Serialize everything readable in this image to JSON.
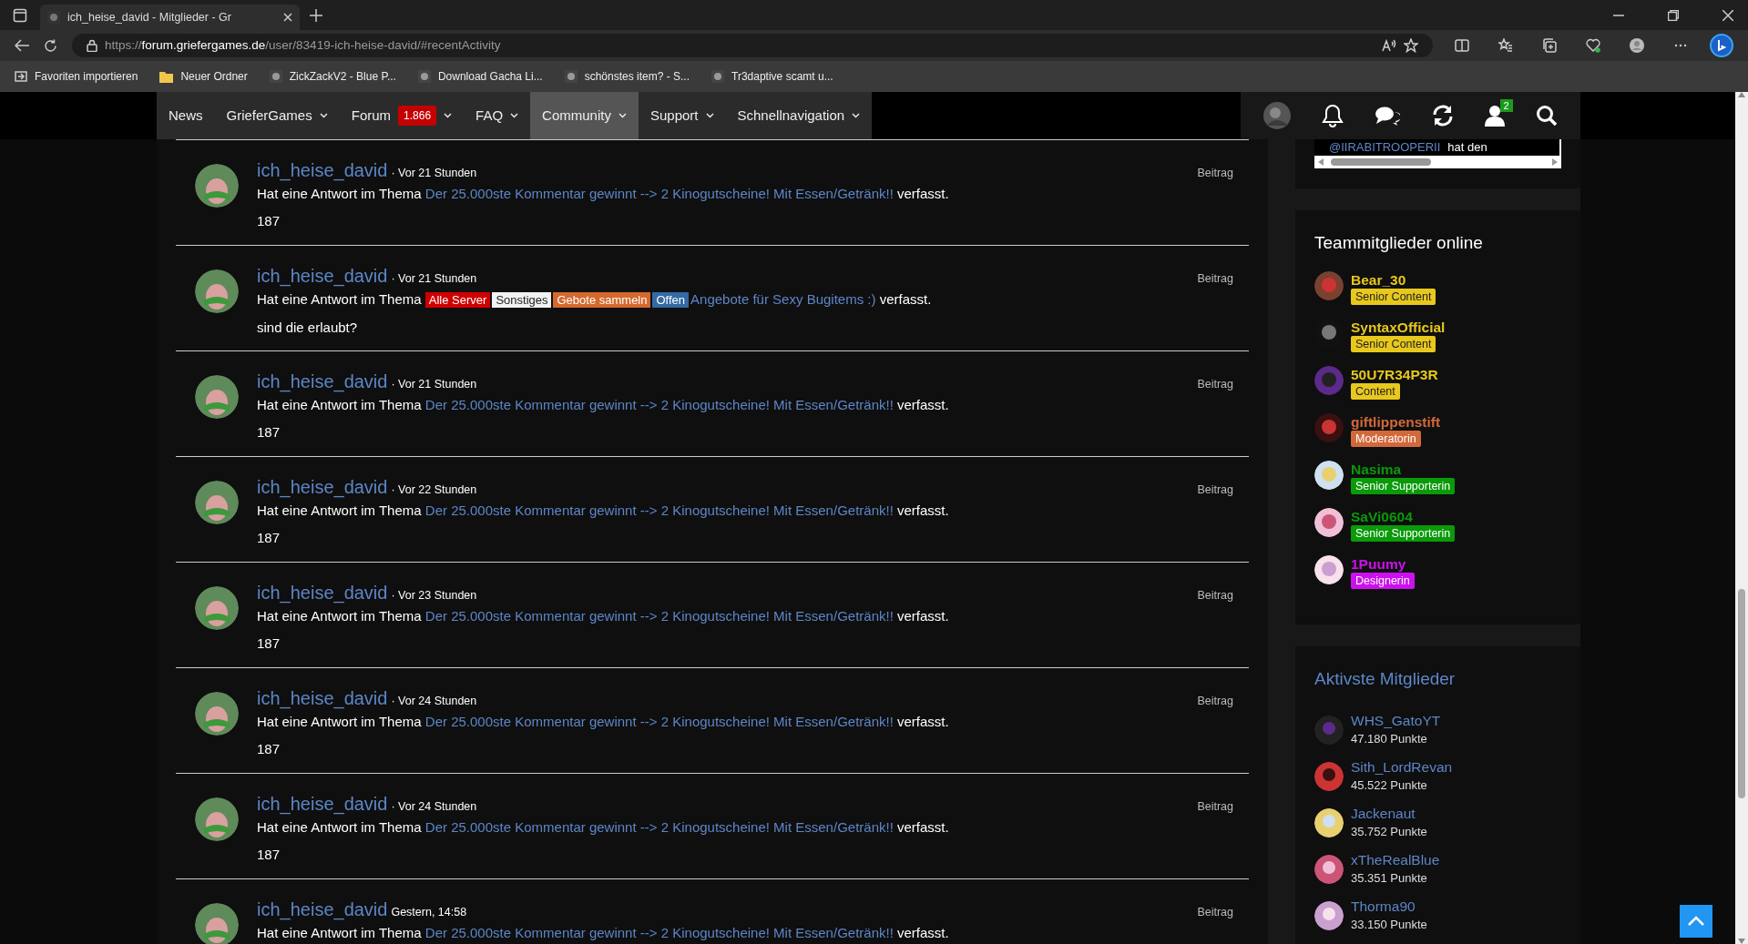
{
  "browser": {
    "tabs": [
      {
        "title": "ich_heise_david - Mitglieder - Gr",
        "selected": true
      }
    ],
    "address": {
      "scheme": "https://",
      "host": "forum.griefergames.de",
      "path": "/user/83419-ich-heise-david/#recentActivity"
    },
    "bookmarks": [
      {
        "label": "Favoriten importieren",
        "kind": "import"
      },
      {
        "label": "Neuer Ordner",
        "kind": "folder"
      },
      {
        "label": "ZickZackV2 - Blue P...",
        "kind": "page"
      },
      {
        "label": "Download Gacha Li...",
        "kind": "page"
      },
      {
        "label": "schönstes item? - S...",
        "kind": "page"
      },
      {
        "label": "Tr3daptive scamt u...",
        "kind": "page"
      }
    ]
  },
  "nav": {
    "items": [
      {
        "label": "News",
        "dropdown": false,
        "selected": false
      },
      {
        "label": "GrieferGames",
        "dropdown": true,
        "selected": false
      },
      {
        "label": "Forum",
        "dropdown": true,
        "badge": "1.866",
        "selected": false
      },
      {
        "label": "FAQ",
        "dropdown": true,
        "selected": false
      },
      {
        "label": "Community",
        "dropdown": true,
        "selected": true
      },
      {
        "label": "Support",
        "dropdown": true,
        "selected": false
      },
      {
        "label": "Schnellnavigation",
        "dropdown": true,
        "selected": false
      }
    ],
    "user_badge": "2"
  },
  "feed": {
    "items": [
      {
        "user": "ich_heise_david",
        "time": "· Vor 21 Stunden",
        "prefix": "Hat eine Antwort im Thema",
        "topic": "Der 25.000ste Kommentar gewinnt --> 2 Kinogutscheine! Mit Essen/Getränk!!",
        "suffix": "verfasst.",
        "body": "187",
        "type": "Beitrag"
      },
      {
        "user": "ich_heise_david",
        "time": "· Vor 21 Stunden",
        "prefix": "Hat eine Antwort im Thema",
        "tags": [
          {
            "label": "Alle Server",
            "color": "#d10000"
          },
          {
            "label": "Sonstiges",
            "color": "#f2f2f2"
          },
          {
            "label": "Gebote sammeln",
            "color": "#d4692e"
          },
          {
            "label": "Offen",
            "color": "#336aa6"
          }
        ],
        "topic": "Angebote für Sexy Bugitems :)",
        "suffix": "verfasst.",
        "body": "sind die erlaubt?",
        "type": "Beitrag"
      },
      {
        "user": "ich_heise_david",
        "time": "· Vor 21 Stunden",
        "prefix": "Hat eine Antwort im Thema",
        "topic": "Der 25.000ste Kommentar gewinnt --> 2 Kinogutscheine! Mit Essen/Getränk!!",
        "suffix": "verfasst.",
        "body": "187",
        "type": "Beitrag"
      },
      {
        "user": "ich_heise_david",
        "time": "· Vor 22 Stunden",
        "prefix": "Hat eine Antwort im Thema",
        "topic": "Der 25.000ste Kommentar gewinnt --> 2 Kinogutscheine! Mit Essen/Getränk!!",
        "suffix": "verfasst.",
        "body": "187",
        "type": "Beitrag"
      },
      {
        "user": "ich_heise_david",
        "time": "· Vor 23 Stunden",
        "prefix": "Hat eine Antwort im Thema",
        "topic": "Der 25.000ste Kommentar gewinnt --> 2 Kinogutscheine! Mit Essen/Getränk!!",
        "suffix": "verfasst.",
        "body": "187",
        "type": "Beitrag"
      },
      {
        "user": "ich_heise_david",
        "time": "· Vor 24 Stunden",
        "prefix": "Hat eine Antwort im Thema",
        "topic": "Der 25.000ste Kommentar gewinnt --> 2 Kinogutscheine! Mit Essen/Getränk!!",
        "suffix": "verfasst.",
        "body": "187",
        "type": "Beitrag"
      },
      {
        "user": "ich_heise_david",
        "time": "· Vor 24 Stunden",
        "prefix": "Hat eine Antwort im Thema",
        "topic": "Der 25.000ste Kommentar gewinnt --> 2 Kinogutscheine! Mit Essen/Getränk!!",
        "suffix": "verfasst.",
        "body": "187",
        "type": "Beitrag"
      },
      {
        "user": "ich_heise_david",
        "time": "Gestern, 14:58",
        "prefix": "Hat eine Antwort im Thema",
        "topic": "Der 25.000ste Kommentar gewinnt --> 2 Kinogutscheine! Mit Essen/Getränk!!",
        "suffix": "verfasst.",
        "type": "Beitrag"
      }
    ]
  },
  "sidebar": {
    "shoutbox": {
      "mention": "@IIRABITROOPERII",
      "text": "hat den"
    },
    "team": {
      "title": "Teammitglieder online",
      "members": [
        {
          "name": "Bear_30",
          "role": "Senior Content",
          "color": "#e8c81c"
        },
        {
          "name": "SyntaxOfficial",
          "role": "Senior Content",
          "color": "#e8c81c"
        },
        {
          "name": "50U7R34P3R",
          "role": "Content",
          "color": "#e8c81c"
        },
        {
          "name": "giftlippenstift",
          "role": "Moderatorin",
          "color": "#d2693a"
        },
        {
          "name": "Nasima",
          "role": "Senior Supporterin",
          "color": "#0a9a0a"
        },
        {
          "name": "SaVi0604",
          "role": "Senior Supporterin",
          "color": "#0a9a0a"
        },
        {
          "name": "1Puumy",
          "role": "Designerin",
          "color": "#cc10ee"
        }
      ]
    },
    "active": {
      "title": "Aktivste Mitglieder",
      "members": [
        {
          "name": "WHS_GatoYT",
          "points": "47.180 Punkte"
        },
        {
          "name": "Sith_LordRevan",
          "points": "45.522 Punkte"
        },
        {
          "name": "Jackenaut",
          "points": "35.752 Punkte"
        },
        {
          "name": "xTheRealBlue",
          "points": "35.351 Punkte"
        },
        {
          "name": "Thorma90",
          "points": "33.150 Punkte"
        }
      ]
    }
  }
}
